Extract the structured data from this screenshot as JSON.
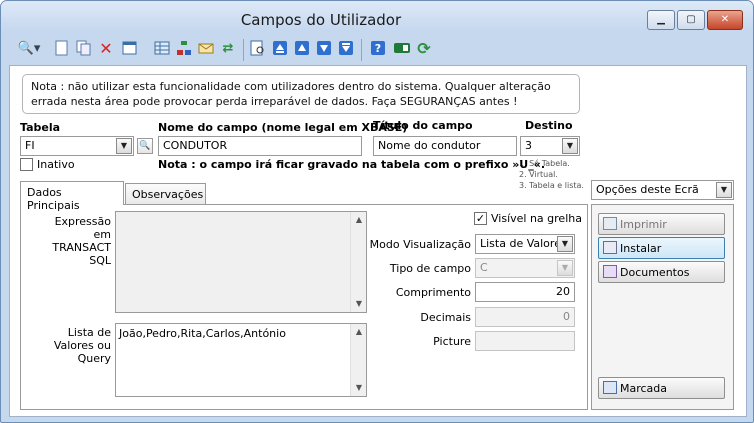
{
  "window": {
    "title": "Campos do Utilizador",
    "minimize": "▁",
    "maximize": "▢",
    "close": "✕"
  },
  "toolbar": {
    "icons": [
      "search-dropdown-icon",
      "new-icon",
      "copy-icon",
      "delete-icon",
      "properties-icon",
      "grid-icon",
      "tree-icon",
      "mail-icon",
      "transfer-icon",
      "preview-icon",
      "first-icon",
      "previous-icon",
      "next-icon",
      "last-icon",
      "help-icon",
      "toggle-icon",
      "refresh-icon"
    ]
  },
  "note": "Nota : não utilizar esta funcionalidade com utilizadores dentro do sistema. Qualquer alteração errada nesta área pode provocar perda irreparável de dados. Faça SEGURANÇAS antes !",
  "form": {
    "tabela_label": "Tabela",
    "tabela_value": "FI",
    "nome_label": "Nome do campo (nome legal em XBASE)",
    "nome_value": "CONDUTOR",
    "titulo_label": "Título do campo",
    "titulo_value": "Nome do condutor",
    "destino_label": "Destino",
    "destino_value": "3",
    "destino_options": [
      "1. Só Tabela.",
      "2. Virtual.",
      "3. Tabela e lista."
    ],
    "inativo_label": "Inativo",
    "inativo_checked": false,
    "prefix_note": "Nota : o campo irá ficar gravado na tabela com o prefixo »U_«."
  },
  "tabs": {
    "principais": "Dados Principais",
    "observacoes": "Observações"
  },
  "panel": {
    "expressao_label": "Expressão em TRANSACT SQL",
    "expressao_value": "",
    "lista_label": "Lista de Valores ou Query",
    "lista_value": "João,Pedro,Rita,Carlos,António",
    "visivel_label": "Visível na grelha",
    "visivel_checked": true,
    "modo_label": "Modo Visualização",
    "modo_value": "Lista de Valores",
    "tipo_label": "Tipo de campo",
    "tipo_value": "C",
    "comprimento_label": "Comprimento",
    "comprimento_value": "20",
    "decimais_label": "Decimais",
    "decimais_value": "0",
    "picture_label": "Picture",
    "picture_value": ""
  },
  "options": {
    "title": "Opções deste Ecrã",
    "buttons": [
      "Imprimir",
      "Instalar",
      "Documentos"
    ],
    "bottom_button": "Marcada"
  }
}
